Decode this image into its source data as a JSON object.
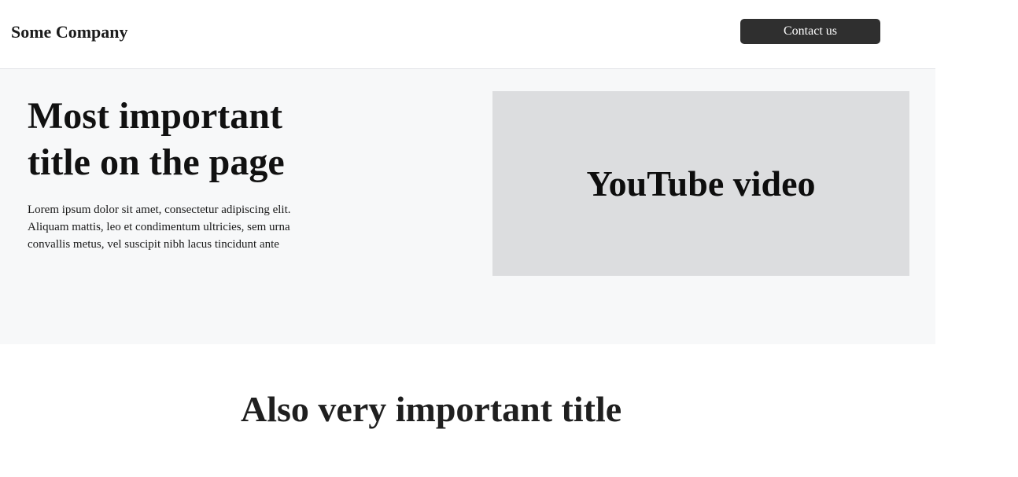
{
  "header": {
    "brand": "Some Company",
    "contact_label": "Contact us"
  },
  "hero": {
    "title": "Most important title on the page",
    "text": "Lorem ipsum dolor sit amet, consectetur adipiscing elit. Aliquam mattis, leo et condimentum ultricies, sem urna convallis metus, vel suscipit nibh lacus tincidunt ante",
    "video_label": "YouTube video"
  },
  "section": {
    "title": "Also very important title"
  },
  "colors": {
    "button_bg": "#2f2f2f",
    "hero_bg": "#f7f8f9",
    "video_bg": "#dcdddf"
  }
}
